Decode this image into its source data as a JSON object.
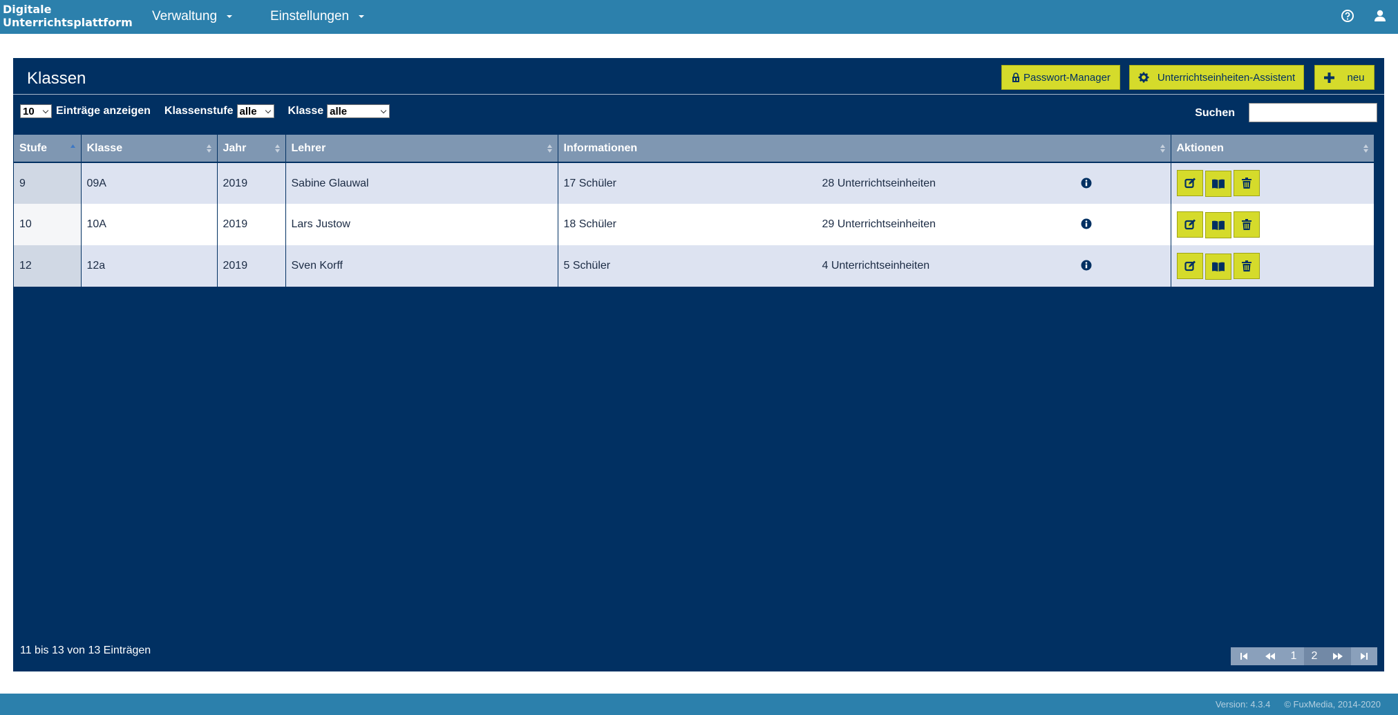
{
  "brand": {
    "line1": "Digitale",
    "line2": "Unterrichtsplattform"
  },
  "nav": {
    "verwaltung": "Verwaltung",
    "einstellungen": "Einstellungen"
  },
  "panel": {
    "title": "Klassen",
    "buttons": {
      "password_manager": "Passwort-Manager",
      "assistant": "Unterrichtseinheiten-Assistent",
      "new": "neu"
    }
  },
  "filters": {
    "page_size": "10",
    "page_size_label": "Einträge anzeigen",
    "grade_label": "Klassenstufe",
    "grade_value": "alle",
    "class_label": "Klasse",
    "class_value": "alle",
    "search_label": "Suchen",
    "search_value": ""
  },
  "table": {
    "headers": {
      "stufe": "Stufe",
      "klasse": "Klasse",
      "jahr": "Jahr",
      "lehrer": "Lehrer",
      "informationen": "Informationen",
      "aktionen": "Aktionen"
    },
    "rows": [
      {
        "stufe": "9",
        "klasse": "09A",
        "jahr": "2019",
        "lehrer": "Sabine Glauwal",
        "schueler": "17 Schüler",
        "einheiten": "28 Unterrichtseinheiten"
      },
      {
        "stufe": "10",
        "klasse": "10A",
        "jahr": "2019",
        "lehrer": "Lars Justow",
        "schueler": "18 Schüler",
        "einheiten": "29 Unterrichtseinheiten"
      },
      {
        "stufe": "12",
        "klasse": "12a",
        "jahr": "2019",
        "lehrer": "Sven Korff",
        "schueler": "5 Schüler",
        "einheiten": "4 Unterrichtseinheiten"
      }
    ]
  },
  "footer": {
    "info": "11 bis 13 von 13 Einträgen",
    "pages": [
      "1",
      "2"
    ],
    "current_page": "2"
  },
  "bottom": {
    "version": "Version: 4.3.4",
    "copyright": "© FuxMedia, 2014-2020"
  },
  "colors": {
    "nav": "#2c80ac",
    "panel": "#013062",
    "accent": "#d5db2b"
  },
  "icons": [
    "chevron-down-icon",
    "help-icon",
    "user-icon",
    "key-icon",
    "gear-icon",
    "plus-icon",
    "info-icon",
    "edit-icon",
    "book-icon",
    "trash-icon",
    "first-page-icon",
    "prev-page-icon",
    "next-page-icon",
    "last-page-icon"
  ]
}
